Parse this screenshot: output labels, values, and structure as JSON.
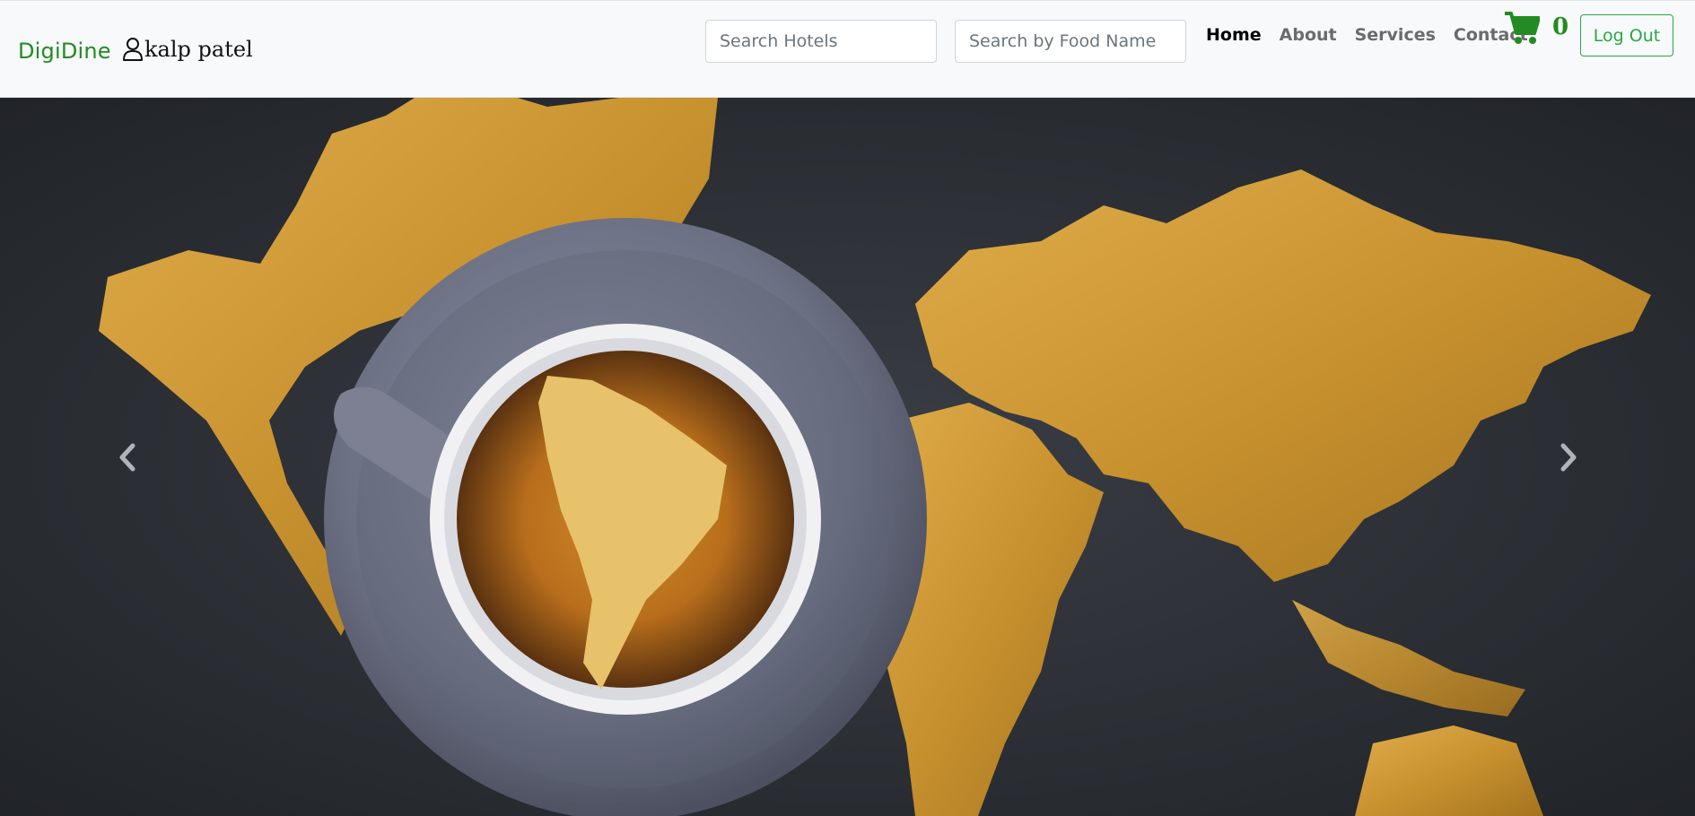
{
  "navbar": {
    "brand": "DigiDine",
    "user_name": "kalp patel",
    "user_icon": "person-icon",
    "search_hotels": {
      "placeholder": "Search Hotels",
      "value": ""
    },
    "search_food": {
      "placeholder": "Search by Food Name",
      "value": ""
    },
    "links": [
      {
        "label": "Home",
        "active": true
      },
      {
        "label": "About",
        "active": false
      },
      {
        "label": "Services",
        "active": false
      },
      {
        "label": "Contact",
        "active": false
      }
    ],
    "cart": {
      "icon": "shopping-cart-icon",
      "count": "0"
    },
    "logout_label": "Log Out"
  },
  "carousel": {
    "image": "coffee-cup-on-gold-world-map",
    "prev_icon": "chevron-left-icon",
    "next_icon": "chevron-right-icon"
  },
  "colors": {
    "brand": "#228b22",
    "logout": "#28a745",
    "navbar_bg": "#f8f9fa",
    "map_gold": "#c8922f",
    "slate": "#2b2e33"
  }
}
